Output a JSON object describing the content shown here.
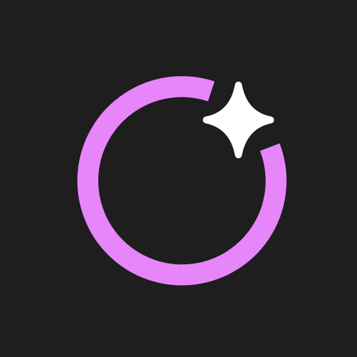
{
  "icon": {
    "name": "ring-with-sparkle-app-icon",
    "colors": {
      "background": "#1e1e1e",
      "ring": "#e785fb",
      "sparkle": "#ffffff"
    },
    "elements": [
      "open-ring-icon",
      "sparkle-star-icon"
    ]
  }
}
